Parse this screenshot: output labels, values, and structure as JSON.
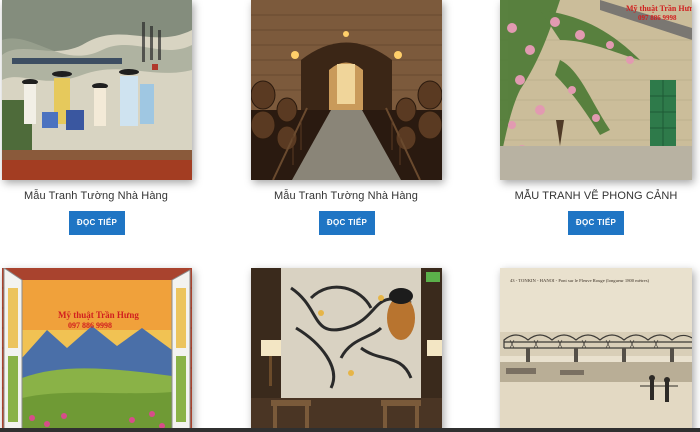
{
  "gallery": {
    "items": [
      {
        "caption": "Mẫu Tranh Tường Nhà Hàng",
        "button": "ĐỌC TIẾP",
        "image": "mural-village-scene"
      },
      {
        "caption": "Mẫu Tranh Tường Nhà Hàng",
        "button": "ĐỌC TIẾP",
        "image": "wine-cellar-barrels"
      },
      {
        "caption": "MẪU TRANH VẼ PHONG CẢNH",
        "button": "ĐỌC TIẾP",
        "image": "rose-vine-house-wall"
      },
      {
        "image": "window-landscape-mural",
        "watermark_name": "Mỹ thuật Trần Hưng",
        "watermark_phone": "097 886 9998"
      },
      {
        "image": "restaurant-wall-mural"
      },
      {
        "image": "old-bridge-postcard",
        "postcard_text": "43 - TONKIN - HANOI - Pont sur le Fleuve Rouge (longueur 1800 mètres)"
      }
    ],
    "watermark": {
      "name": "Mỹ thuật Trần Hưng",
      "phone": "097 886 9998"
    }
  },
  "colors": {
    "button_bg": "#1f75c4",
    "button_text": "#ffffff",
    "caption_text": "#333333"
  }
}
